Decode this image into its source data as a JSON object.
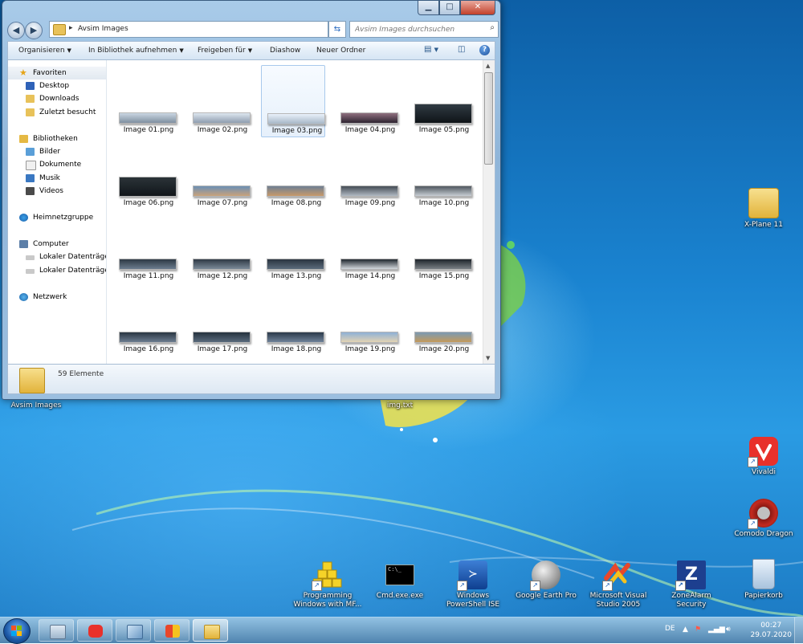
{
  "window": {
    "address_path": "Avsim Images",
    "search_placeholder": "Avsim Images durchsuchen",
    "toolbar": {
      "organize": "Organisieren",
      "include_library": "In Bibliothek aufnehmen",
      "share_with": "Freigeben für",
      "slideshow": "Diashow",
      "new_folder": "Neuer Ordner"
    },
    "nav": {
      "favorites": "Favoriten",
      "desktop": "Desktop",
      "downloads": "Downloads",
      "recent": "Zuletzt besucht",
      "libraries": "Bibliotheken",
      "pictures": "Bilder",
      "documents": "Dokumente",
      "music": "Musik",
      "videos": "Videos",
      "homegroup": "Heimnetzgruppe",
      "computer": "Computer",
      "local_disk_1": "Lokaler Datenträger",
      "local_disk_2": "Lokaler Datenträger",
      "network": "Netzwerk"
    },
    "files": [
      "Image 01.png",
      "Image 02.png",
      "Image 03.png",
      "Image 04.png",
      "Image 05.png",
      "Image 06.png",
      "Image 07.png",
      "Image 08.png",
      "Image 09.png",
      "Image 10.png",
      "Image 11.png",
      "Image 12.png",
      "Image 13.png",
      "Image 14.png",
      "Image 15.png",
      "Image 16.png",
      "Image 17.png",
      "Image 18.png",
      "Image 19.png",
      "Image 20.png"
    ],
    "selected_file_index": 2,
    "details_count": "59 Elemente"
  },
  "desktop_icons": {
    "xplane": "X-Plane 11",
    "avsim": "Avsim Images",
    "imgtxt": "img.txt",
    "vivaldi": "Vivaldi",
    "comodo": "Comodo Dragon",
    "programming": "Programming Windows with MF...",
    "cmd": "Cmd.exe.exe",
    "powershell": "Windows PowerShell ISE",
    "google_earth": "Google Earth Pro",
    "visual_studio": "Microsoft Visual Studio 2005",
    "zonealarm": "ZoneAlarm Security",
    "recycle_bin": "Papierkorb"
  },
  "taskbar": {
    "language": "DE",
    "time": "00:27",
    "date": "29.07.2020"
  },
  "colors": {
    "desktop_blue": "#1a83d0",
    "vivaldi_red": "#e8312b",
    "folder_yellow": "#e8c25a"
  }
}
